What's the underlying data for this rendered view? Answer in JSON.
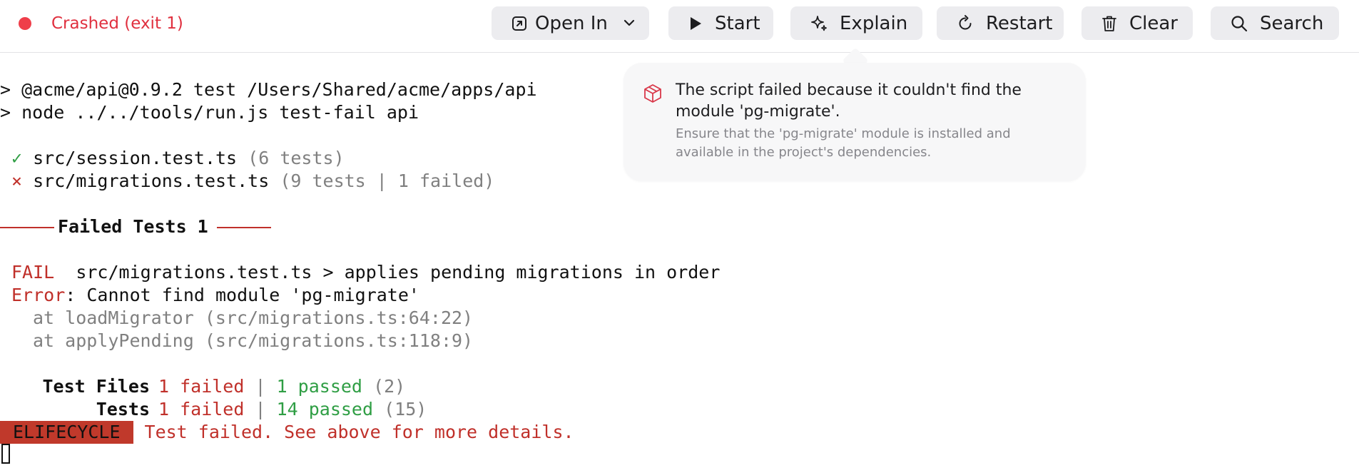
{
  "status": {
    "text": "Crashed (exit 1)",
    "dot_color": "#ef3e4a"
  },
  "toolbar": {
    "open_in": {
      "label": "Open In",
      "icon": "open-external-icon",
      "menu_icon": "chevron-down-icon"
    },
    "start": {
      "label": "Start",
      "icon": "play-icon"
    },
    "explain": {
      "label": "Explain",
      "icon": "sparkle-icon"
    },
    "restart": {
      "label": "Restart",
      "icon": "restart-icon"
    },
    "clear": {
      "label": "Clear",
      "icon": "trash-icon"
    },
    "search": {
      "label": "Search",
      "icon": "search-icon"
    }
  },
  "explanation": {
    "icon": "package-icon",
    "title": "The script failed because it couldn't find the module 'pg-migrate'.",
    "body": "Ensure that the 'pg-migrate' module is installed and available in the project's dependencies."
  },
  "terminal": {
    "cmd1": "> @acme/api@0.9.2 test /Users/Shared/acme/apps/api",
    "cmd2": "> node ../../tools/run.js test-fail api",
    "file1": {
      "mark": "✓",
      "name": "src/session.test.ts",
      "meta": "(6 tests)"
    },
    "file2": {
      "mark": "×",
      "name": "src/migrations.test.ts",
      "meta": "(9 tests | 1 failed)"
    },
    "failed_header": "Failed Tests 1",
    "fail_tag": "FAIL",
    "fail_test": "src/migrations.test.ts > applies pending migrations in order",
    "error_label": "Error",
    "error_msg": ": Cannot find module 'pg-migrate'",
    "stack1": "at loadMigrator (src/migrations.ts:64:22)",
    "stack2": "at applyPending (src/migrations.ts:118:9)",
    "summary_files": {
      "label": "Test Files",
      "failed": "1 failed",
      "sep": " | ",
      "passed": "1 passed",
      "total": "(2)"
    },
    "summary_tests": {
      "label": "Tests",
      "failed": "1 failed",
      "sep": " | ",
      "passed": "14 passed",
      "total": "(15)"
    },
    "lifecycle_badge": "ELIFECYCLE",
    "lifecycle_msg": "Test failed. See above for more details."
  },
  "colors": {
    "error": "#c0302a",
    "success": "#2f9e44",
    "muted": "#808080",
    "badge_bg": "#c0392b"
  }
}
